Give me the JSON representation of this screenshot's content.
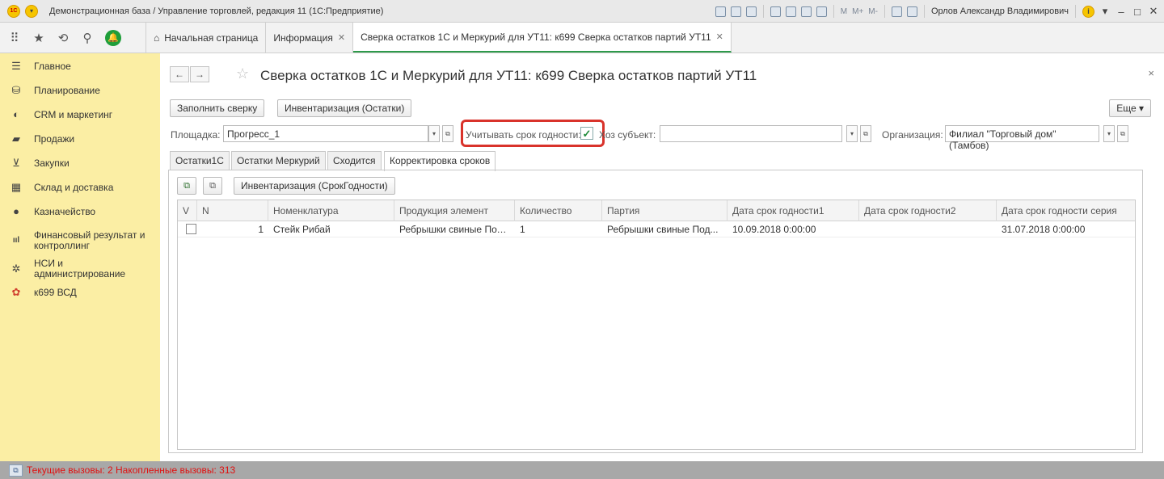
{
  "window": {
    "title": "Демонстрационная база / Управление торговлей, редакция 11 (1С:Предприятие)",
    "logo_text": "1С",
    "menu_symbol": "▾",
    "toolbar_memory": [
      "M",
      "M+",
      "M-"
    ],
    "user": "Орлов Александр Владимирович",
    "info_symbol": "i",
    "dropdown_symbol": "▾",
    "minimize": "–",
    "maximize": "□",
    "close": "✕"
  },
  "nav": {
    "apps_symbol": "⠿",
    "favorites_symbol": "★",
    "history_symbol": "⟲",
    "search_symbol": "⚲",
    "bell_symbol": "🔔"
  },
  "tabs": [
    {
      "label": "Начальная страница",
      "home": "⌂"
    },
    {
      "label": "Информация",
      "close": "✕"
    },
    {
      "label": "Сверка остатков 1С и Меркурий для УТ11: к699 Сверка остатков партий УТ11",
      "close": "✕",
      "active": true
    }
  ],
  "sidebar": [
    {
      "label": "Главное",
      "icon": "list-icon",
      "glyph": "☰"
    },
    {
      "label": "Планирование",
      "icon": "planning-icon",
      "glyph": "⛁"
    },
    {
      "label": "CRM и маркетинг",
      "icon": "crm-icon",
      "glyph": "◐"
    },
    {
      "label": "Продажи",
      "icon": "sales-icon",
      "glyph": "▰"
    },
    {
      "label": "Закупки",
      "icon": "cart-icon",
      "glyph": "⊻"
    },
    {
      "label": "Склад и доставка",
      "icon": "warehouse-icon",
      "glyph": "▦"
    },
    {
      "label": "Казначейство",
      "icon": "treasury-icon",
      "glyph": "●"
    },
    {
      "label": "Финансовый результат и контроллинг",
      "icon": "chart-icon",
      "glyph": "ııl"
    },
    {
      "label": "НСИ и администрирование",
      "icon": "gear-icon",
      "glyph": "✲"
    },
    {
      "label": "к699 ВСД",
      "icon": "vsd-icon",
      "glyph": "✿"
    }
  ],
  "form": {
    "back": "←",
    "forward": "→",
    "star": "☆",
    "title": "Сверка остатков 1С и Меркурий для УТ11: к699 Сверка остатков партий УТ11",
    "close": "×",
    "fill_button": "Заполнить сверку",
    "inventory_button": "Инвентаризация (Остатки)",
    "more_button": "Еще ▾",
    "site_label": "Площадка:",
    "site_value": "Прогресс_1",
    "expiry_label": "Учитывать срок годности:",
    "expiry_checked": "✓",
    "subject_label": "Хоз субъект:",
    "subject_value": "",
    "org_label": "Организация:",
    "org_value": "Филиал \"Торговый дом\" (Тамбов)",
    "dd_arrow": "▾",
    "open_symbol": "⧉"
  },
  "form_tabs": [
    "Остатки1С",
    "Остатки Меркурий",
    "Сходится",
    "Корректировка сроков"
  ],
  "subtoolbar": {
    "icon1": "⧉",
    "icon2": "⧉",
    "inventory_expiry_button": "Инвентаризация (СрокГодности)"
  },
  "grid": {
    "columns": [
      "V",
      "N",
      "Номенклатура",
      "Продукция элемент",
      "Количество",
      "Партия",
      "Дата срок годности1",
      "Дата срок годности2",
      "Дата срок годности серия"
    ],
    "rows": [
      {
        "n": "1",
        "nomenclature": "Стейк Рибай",
        "product": "Ребрышки свиные Под...",
        "qty": "1",
        "batch": "Ребрышки свиные Под...",
        "date1": "10.09.2018 0:00:00",
        "date2": "",
        "series_date": "31.07.2018 0:00:00"
      }
    ]
  },
  "status": {
    "icon": "⧉",
    "text": "Текущие вызовы: 2   Накопленные вызовы: 313"
  }
}
